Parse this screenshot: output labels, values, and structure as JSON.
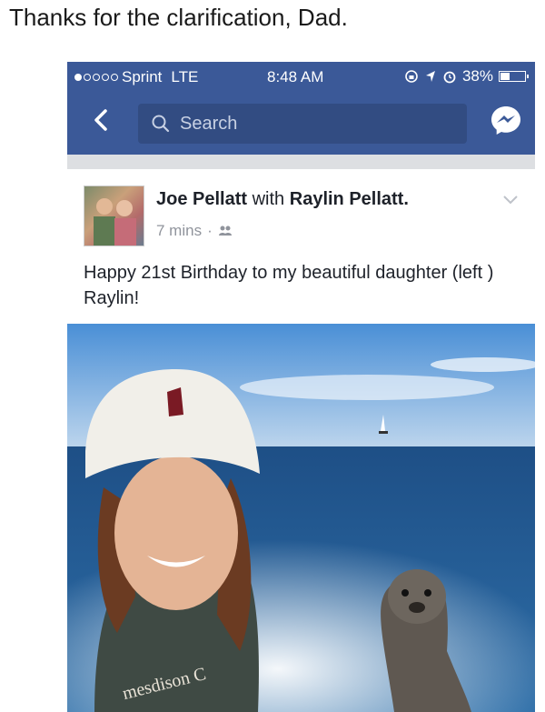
{
  "caption": "Thanks for the clarification, Dad.",
  "status_bar": {
    "carrier": "Sprint",
    "network": "LTE",
    "time": "8:48 AM",
    "battery": "38%",
    "battery_level": 0.38,
    "signal_bars_filled": 1,
    "signal_bars_total": 5
  },
  "nav": {
    "search_placeholder": "Search",
    "back_icon": "chevron-left-icon",
    "messenger_icon": "messenger-icon"
  },
  "post": {
    "author": "Joe Pellatt",
    "with_word": "with",
    "tagged": "Raylin Pellatt.",
    "time": "7 mins",
    "privacy_icon": "friends-icon",
    "text": "Happy 21st Birthday to my beautiful daughter (left ) Raylin!",
    "photo_text": "mesdison C"
  },
  "colors": {
    "facebook_blue": "#3b5998",
    "search_bg": "#324c82",
    "text": "#1d2129",
    "meta": "#90949c"
  }
}
